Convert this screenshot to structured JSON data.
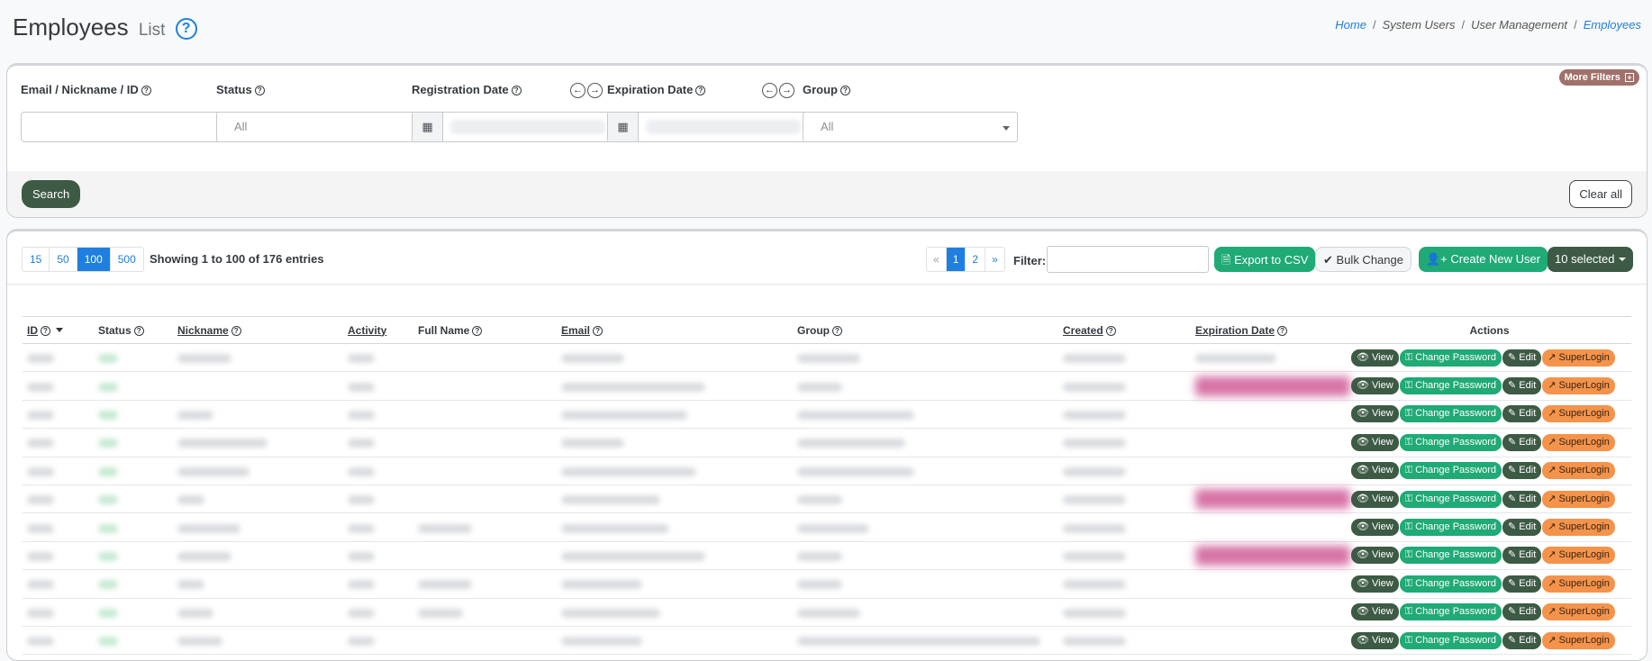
{
  "page": {
    "title": "Employees",
    "subtitle": "List",
    "help_glyph": "?"
  },
  "breadcrumb": {
    "items": [
      "Home",
      "System Users",
      "User Management",
      "Employees"
    ]
  },
  "filters": {
    "more_filters_label": "More Filters",
    "email_label": "Email / Nickname / ID",
    "status_label": "Status",
    "status_value": "All",
    "registration_label": "Registration Date",
    "expiration_label": "Expiration Date",
    "group_label": "Group",
    "group_value": "All",
    "search_label": "Search",
    "clear_label": "Clear all"
  },
  "table_controls": {
    "page_sizes": [
      "15",
      "50",
      "100",
      "500"
    ],
    "active_page_size": "100",
    "entries_info": "Showing 1 to 100 of 176 entries",
    "pagination": [
      "«",
      "1",
      "2",
      "»"
    ],
    "filter_label": "Filter:",
    "export_label": "Export to CSV",
    "bulk_label": "Bulk Change",
    "create_label": "Create New User",
    "selected_label": "10 selected"
  },
  "table": {
    "columns": [
      "ID",
      "Status",
      "Nickname",
      "Activity",
      "Full Name",
      "Email",
      "Group",
      "Created",
      "Expiration Date",
      "Actions"
    ],
    "row_count": 11,
    "action_labels": {
      "view": "View",
      "change_password": "Change Password",
      "edit": "Edit",
      "superlogin": "SuperLogin"
    }
  },
  "colors": {
    "accent_blue": "#1e7fe0",
    "dark_green": "#3d5a44",
    "green": "#1faa76",
    "orange": "#f4934b",
    "pink_blur": "#d773a6"
  },
  "icons": {
    "help": "question-circle-icon",
    "calendar": "calendar-icon",
    "arrow_left": "arrow-left-icon",
    "arrow_right": "arrow-right-icon",
    "export": "file-csv-icon",
    "bulk": "check-icon",
    "create": "user-plus-icon",
    "view": "eye-icon",
    "password": "key-icon",
    "edit": "edit-icon",
    "superlogin": "external-login-icon"
  }
}
